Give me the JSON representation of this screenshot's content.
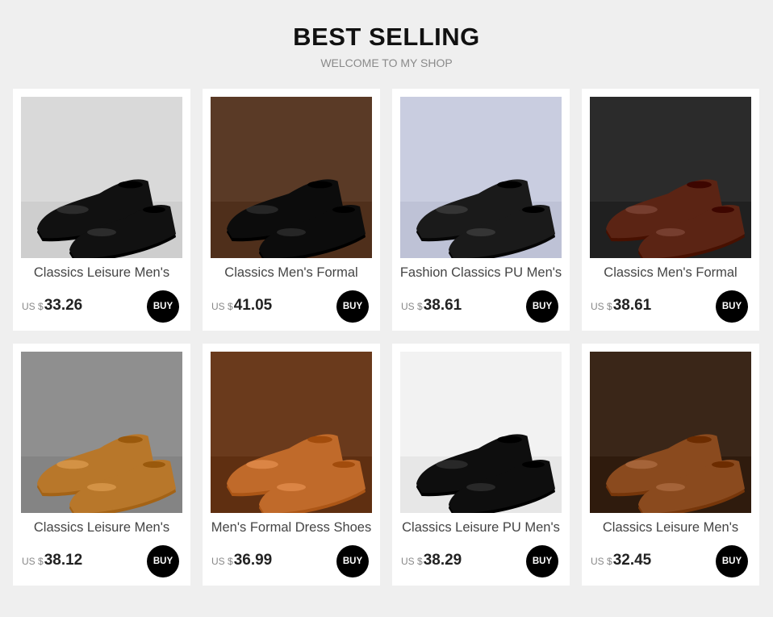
{
  "header": {
    "title": "BEST SELLING",
    "subtitle": "WELCOME TO MY SHOP"
  },
  "products": [
    {
      "name": "Classics Leisure Men's",
      "currency": "US $",
      "price": "33.26",
      "buy_label": "BUY",
      "image": "black-leather-oxford-shoe",
      "bg_color": "#d9d9d9",
      "shoe_color": "#111111"
    },
    {
      "name": "Classics Men's Formal",
      "currency": "US $",
      "price": "41.05",
      "buy_label": "BUY",
      "image": "black-croc-leather-shoe-with-watch",
      "bg_color": "#5a3a26",
      "shoe_color": "#0c0c0c"
    },
    {
      "name": "Fashion Classics PU Men's",
      "currency": "US $",
      "price": "38.61",
      "buy_label": "BUY",
      "image": "black-studded-loafers",
      "bg_color": "#c9cde0",
      "shoe_color": "#1a1a1a"
    },
    {
      "name": "Classics Men's Formal",
      "currency": "US $",
      "price": "38.61",
      "buy_label": "BUY",
      "image": "brown-leather-oxford-shoes",
      "bg_color": "#2b2b2b",
      "shoe_color": "#5b2414"
    },
    {
      "name": "Classics Leisure Men's",
      "currency": "US $",
      "price": "38.12",
      "buy_label": "BUY",
      "image": "tan-leather-shoes-on-feet",
      "bg_color": "#8f8f8f",
      "shoe_color": "#b8772a"
    },
    {
      "name": "Men's Formal Dress Shoes",
      "currency": "US $",
      "price": "36.99",
      "buy_label": "BUY",
      "image": "tan-monk-strap-shoes-on-feet",
      "bg_color": "#6a3a1c",
      "shoe_color": "#c06a2a"
    },
    {
      "name": "Classics Leisure PU Men's",
      "currency": "US $",
      "price": "38.29",
      "buy_label": "BUY",
      "image": "black-tassel-loafers",
      "bg_color": "#f2f2f2",
      "shoe_color": "#0e0e0e"
    },
    {
      "name": "Classics Leisure Men's",
      "currency": "US $",
      "price": "32.45",
      "buy_label": "BUY",
      "image": "brown-leather-derby-shoes",
      "bg_color": "#3a2618",
      "shoe_color": "#8a4a1e"
    }
  ]
}
